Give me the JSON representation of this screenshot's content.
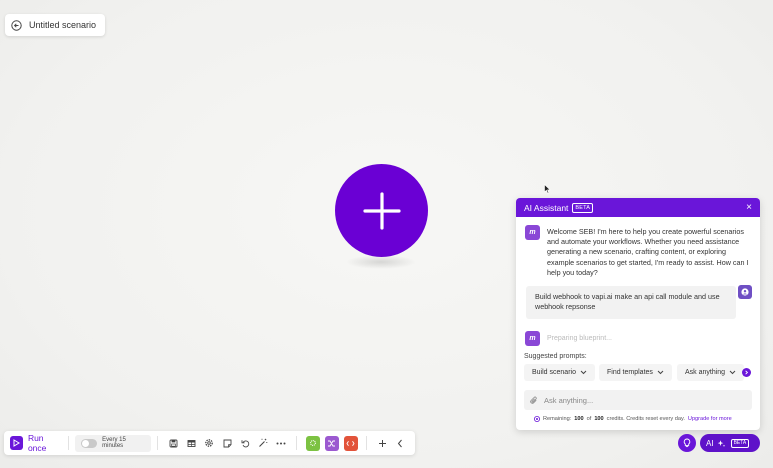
{
  "scenario": {
    "title": "Untitled scenario"
  },
  "assistant": {
    "title": "AI Assistant",
    "badge": "BETA",
    "close": "×",
    "bot_avatar_text": "m",
    "welcome": "Welcome SEB! I'm here to help you create powerful scenarios and automate your workflows. Whether you need assistance generating a new scenario, crafting content, or exploring example scenarios to get started, I'm ready to assist. How can I help you today?",
    "user_message": "Build webhook to vapi.ai make an api call module and use webhook repsonse",
    "status": "Preparing blueprint...",
    "suggested_label": "Suggested prompts:",
    "prompts": [
      "Build scenario",
      "Find templates",
      "Ask anything"
    ],
    "input_placeholder": "Ask anything...",
    "remaining_prefix": "Remaining:",
    "remaining_used": "100",
    "remaining_of": "of",
    "remaining_total": "100",
    "remaining_suffix": "credits. Credits reset every day.",
    "upgrade": "Upgrade for more"
  },
  "toolbar": {
    "run_label": "Run once",
    "schedule_label": "Every 15 minutes"
  },
  "ai_toggle": {
    "label": "AI",
    "badge": "BETA"
  },
  "colors": {
    "brand": "#6a16d9",
    "green": "#7cc242",
    "purple_tool": "#9b59d0",
    "red_tool": "#e2533a"
  }
}
